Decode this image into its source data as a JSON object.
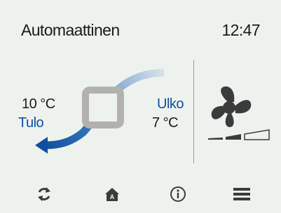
{
  "header": {
    "mode": "Automaattinen",
    "time": "12:47"
  },
  "flow": {
    "supply_temp": "10 °C",
    "supply_label": "Tulo",
    "outdoor_label": "Ulko",
    "outdoor_temp": "7 °C"
  },
  "fan": {
    "icon": "fan-icon",
    "speed_indicator_icon": "fan-speed-bars-icon"
  },
  "nav": {
    "items": [
      {
        "icon": "refresh-icon",
        "name": "nav-refresh-button"
      },
      {
        "icon": "home-icon",
        "name": "nav-home-button"
      },
      {
        "icon": "info-icon",
        "name": "nav-info-button"
      },
      {
        "icon": "menu-icon",
        "name": "nav-menu-button"
      }
    ]
  },
  "colors": {
    "background": "#eef2ee",
    "accent_blue": "#0f4f9e",
    "exchanger_grey": "#b3b1ad",
    "icon_dark": "#3b3b3b"
  }
}
